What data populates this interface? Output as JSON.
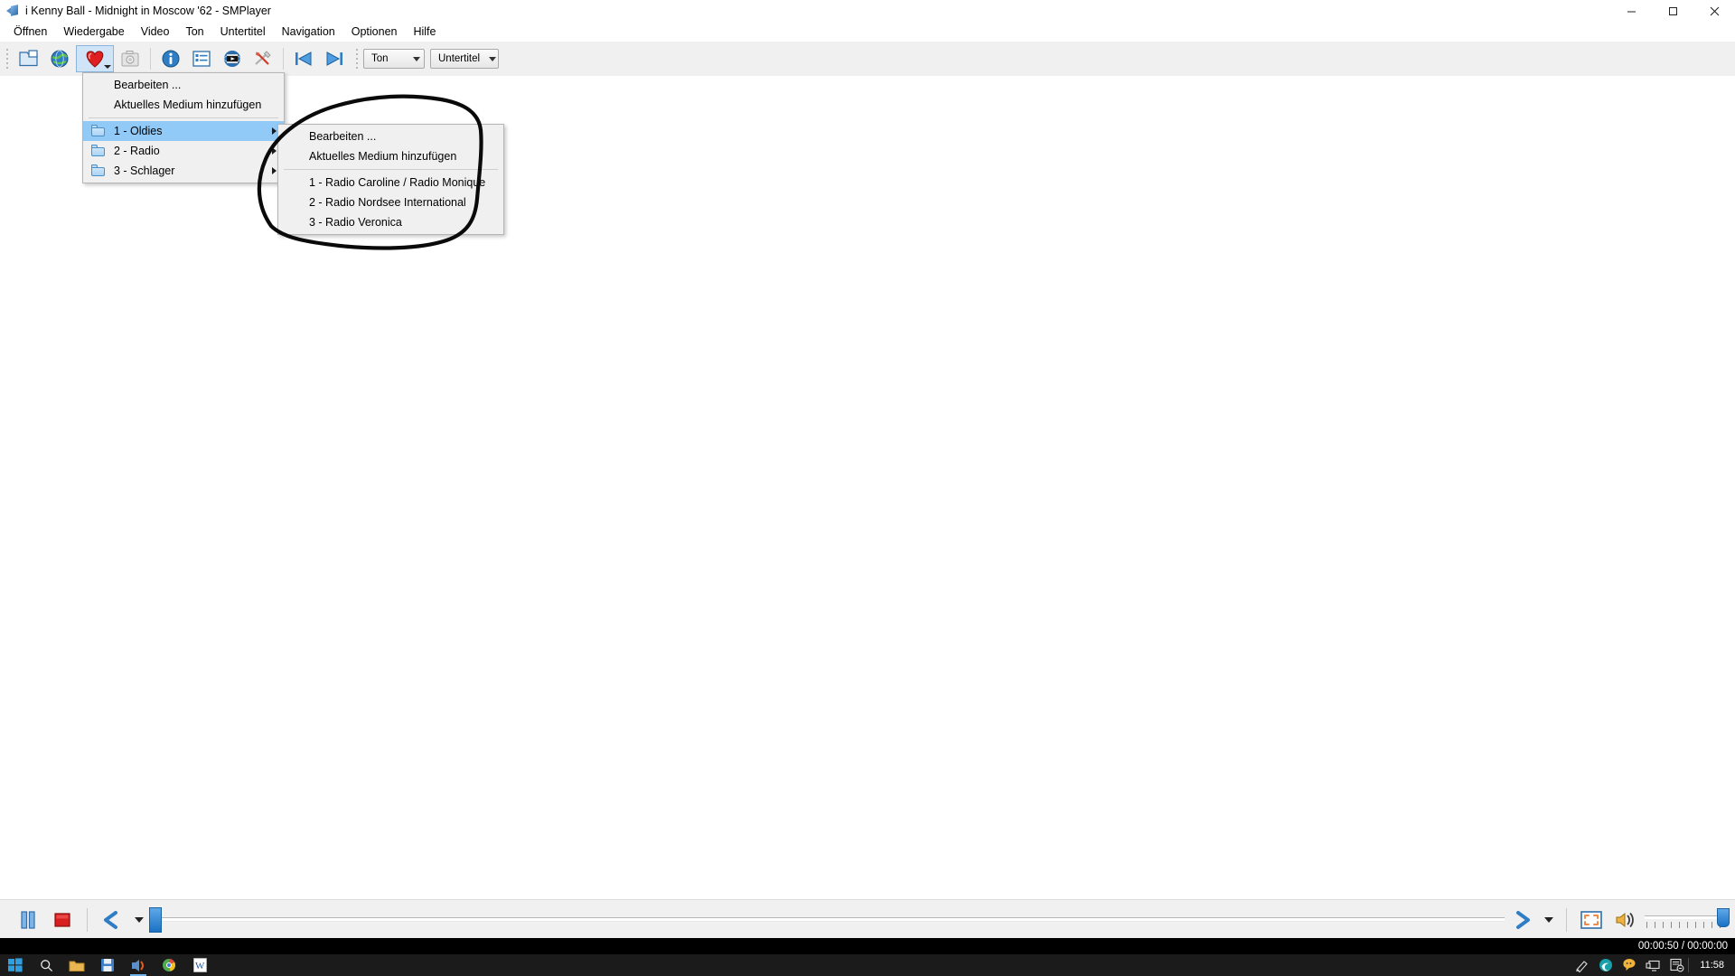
{
  "window": {
    "title": "i Kenny Ball - Midnight in Moscow  '62 - SMPlayer",
    "app_icon": "smplayer-icon",
    "minimize_label": "Minimieren",
    "maximize_label": "Maximieren",
    "close_label": "Schließen"
  },
  "menubar": {
    "items": [
      {
        "label": "Öffnen",
        "name": "menubar-item-offnen"
      },
      {
        "label": "Wiedergabe",
        "name": "menubar-item-wiedergabe"
      },
      {
        "label": "Video",
        "name": "menubar-item-video"
      },
      {
        "label": "Ton",
        "name": "menubar-item-ton"
      },
      {
        "label": "Untertitel",
        "name": "menubar-item-untertitel"
      },
      {
        "label": "Navigation",
        "name": "menubar-item-navigation"
      },
      {
        "label": "Optionen",
        "name": "menubar-item-optionen"
      },
      {
        "label": "Hilfe",
        "name": "menubar-item-hilfe"
      }
    ]
  },
  "toolbar": {
    "buttons": [
      {
        "name": "open-file-button",
        "icon": "open-folder-icon",
        "tooltip": "Datei öffnen"
      },
      {
        "name": "open-url-button",
        "icon": "globe-icon",
        "tooltip": "URL öffnen"
      },
      {
        "name": "favorites-button",
        "icon": "heart-icon",
        "tooltip": "Favoriten",
        "active": true
      },
      {
        "name": "screenshot-button",
        "icon": "camera-icon",
        "tooltip": "Bildschirmfoto"
      },
      {
        "name": "info-button",
        "icon": "info-icon",
        "tooltip": "Eigenschaften"
      },
      {
        "name": "playlist-button",
        "icon": "playlist-icon",
        "tooltip": "Wiedergabeliste"
      },
      {
        "name": "video-preview-button",
        "icon": "film-globe-icon",
        "tooltip": "Video-Vorschau"
      },
      {
        "name": "preferences-button",
        "icon": "tools-icon",
        "tooltip": "Einstellungen"
      },
      {
        "name": "previous-button",
        "icon": "skip-previous-icon",
        "tooltip": "Vorheriger"
      },
      {
        "name": "next-button",
        "icon": "skip-next-icon",
        "tooltip": "Nächster"
      }
    ],
    "audio_combo": {
      "label": "Ton",
      "name": "audio-track-combo"
    },
    "subtitle_combo": {
      "label": "Untertitel",
      "name": "subtitle-track-combo"
    }
  },
  "favorites_menu": {
    "items": [
      {
        "label": "Bearbeiten ...",
        "type": "action",
        "name": "favorites-edit"
      },
      {
        "label": "Aktuelles Medium hinzufügen",
        "type": "action",
        "name": "favorites-add-current"
      },
      {
        "type": "separator"
      },
      {
        "label": "1 - Oldies",
        "type": "submenu",
        "icon": "folder-icon",
        "selected": true,
        "name": "favorites-folder-oldies"
      },
      {
        "label": "2 - Radio",
        "type": "submenu",
        "icon": "folder-icon",
        "selected": false,
        "name": "favorites-folder-radio"
      },
      {
        "label": "3 - Schlager",
        "type": "submenu",
        "icon": "folder-icon",
        "selected": false,
        "name": "favorites-folder-schlager"
      }
    ]
  },
  "favorites_submenu": {
    "items": [
      {
        "label": "Bearbeiten ...",
        "type": "action",
        "name": "submenu-edit"
      },
      {
        "label": "Aktuelles Medium hinzufügen",
        "type": "action",
        "name": "submenu-add-current"
      },
      {
        "type": "separator"
      },
      {
        "label": "1 - Radio Caroline / Radio Monique",
        "type": "action",
        "name": "submenu-station-1"
      },
      {
        "label": "2 - Radio Nordsee International",
        "type": "action",
        "name": "submenu-station-2"
      },
      {
        "label": "3 - Radio Veronica",
        "type": "action",
        "name": "submenu-station-3"
      }
    ]
  },
  "annotation": {
    "type": "hand-drawn-ellipse",
    "color": "#000000",
    "target": "favorites_submenu"
  },
  "controls": {
    "buttons": [
      {
        "name": "pause-button",
        "icon": "pause-icon"
      },
      {
        "name": "stop-button",
        "icon": "stop-icon"
      },
      {
        "name": "rewind-button",
        "icon": "rewind-icon"
      },
      {
        "name": "forward-button",
        "icon": "forward-icon"
      },
      {
        "name": "fullscreen-button",
        "icon": "fullscreen-icon"
      },
      {
        "name": "mute-button",
        "icon": "speaker-icon"
      }
    ],
    "seek_position_percent": 0,
    "volume_percent": 100
  },
  "status": {
    "time_display": "00:00:50 / 00:00:00",
    "current_time": "00:00:50",
    "total_time": "00:00:00"
  },
  "taskbar": {
    "items": [
      {
        "name": "start-button",
        "icon": "windows-icon"
      },
      {
        "name": "search-button",
        "icon": "search-icon"
      },
      {
        "name": "taskview-button",
        "icon": "folder-icon"
      },
      {
        "name": "taskbar-save-icon",
        "icon": "floppy-disk-icon"
      },
      {
        "name": "taskbar-smplayer",
        "icon": "smplayer-icon",
        "running": true
      },
      {
        "name": "taskbar-browser",
        "icon": "chrome-icon"
      },
      {
        "name": "taskbar-word",
        "icon": "word-icon"
      }
    ],
    "tray": [
      {
        "name": "tray-pen-icon",
        "icon": "pen-icon"
      },
      {
        "name": "tray-edge-icon",
        "icon": "edge-icon"
      },
      {
        "name": "tray-chat-icon",
        "icon": "chat-icon"
      },
      {
        "name": "tray-display-icon",
        "icon": "display-icon"
      },
      {
        "name": "tray-notification-icon",
        "icon": "notification-icon"
      }
    ],
    "clock": "11:58"
  }
}
